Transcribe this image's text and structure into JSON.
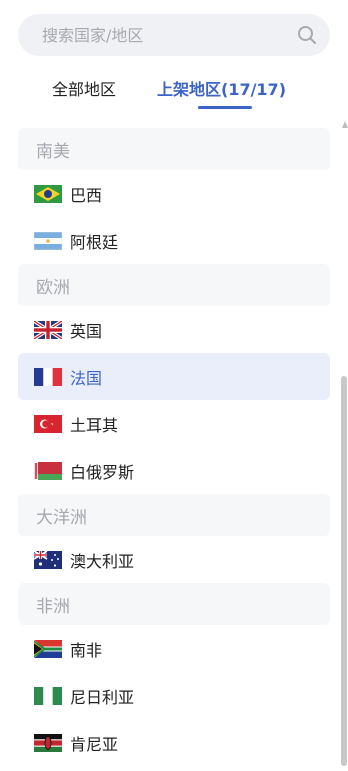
{
  "search": {
    "placeholder": "搜索国家/地区",
    "icon": "search-icon"
  },
  "tabs": [
    {
      "label": "全部地区",
      "active": false
    },
    {
      "label": "上架地区(17/17)",
      "active": true
    }
  ],
  "groups": [
    {
      "title": "南美",
      "items": [
        {
          "name": "巴西",
          "flag": "brazil"
        },
        {
          "name": "阿根廷",
          "flag": "argentina"
        }
      ]
    },
    {
      "title": "欧洲",
      "items": [
        {
          "name": "英国",
          "flag": "uk"
        },
        {
          "name": "法国",
          "flag": "france",
          "selected": true
        },
        {
          "name": "土耳其",
          "flag": "turkey"
        },
        {
          "name": "白俄罗斯",
          "flag": "belarus"
        }
      ]
    },
    {
      "title": "大洋洲",
      "items": [
        {
          "name": "澳大利亚",
          "flag": "australia"
        }
      ]
    },
    {
      "title": "非洲",
      "items": [
        {
          "name": "南非",
          "flag": "south-africa"
        },
        {
          "name": "尼日利亚",
          "flag": "nigeria"
        },
        {
          "name": "肯尼亚",
          "flag": "kenya"
        }
      ]
    }
  ],
  "colors": {
    "accent": "#3c64c8",
    "selected_bg": "#e9eefa",
    "group_bg": "#f6f7f9"
  }
}
